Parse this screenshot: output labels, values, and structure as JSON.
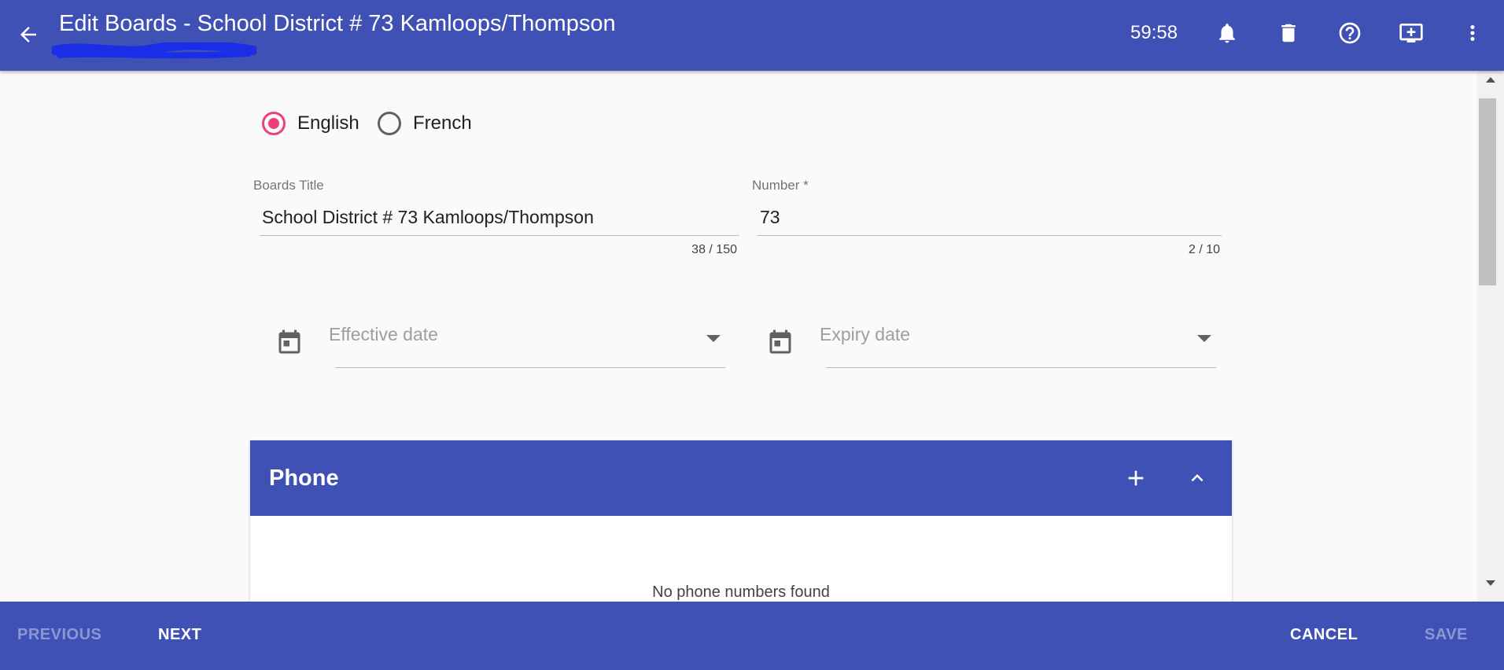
{
  "header": {
    "title": "Edit Boards - School District # 73 Kamloops/Thompson",
    "timer": "59:58",
    "icons": [
      "arrow-back-icon",
      "bell-icon",
      "trash-icon",
      "help-circle-icon",
      "add-screen-icon",
      "more-vert-icon"
    ],
    "color": "#3f51b5"
  },
  "form": {
    "language_options": [
      {
        "label": "English",
        "selected": true
      },
      {
        "label": "French",
        "selected": false
      }
    ],
    "boards_title": {
      "label": "Boards Title",
      "value": "School District # 73 Kamloops/Thompson",
      "counter": "38 / 150"
    },
    "number": {
      "label": "Number *",
      "value": "73",
      "counter": "2 / 10"
    },
    "effective_date": {
      "placeholder": "Effective date"
    },
    "expiry_date": {
      "placeholder": "Expiry date"
    }
  },
  "phone_section": {
    "title": "Phone",
    "empty_message": "No phone numbers found"
  },
  "footer": {
    "previous": "PREVIOUS",
    "next": "NEXT",
    "cancel": "CANCEL",
    "save": "SAVE"
  },
  "colors": {
    "primary": "#3f51b5",
    "accent": "#ec407a"
  }
}
